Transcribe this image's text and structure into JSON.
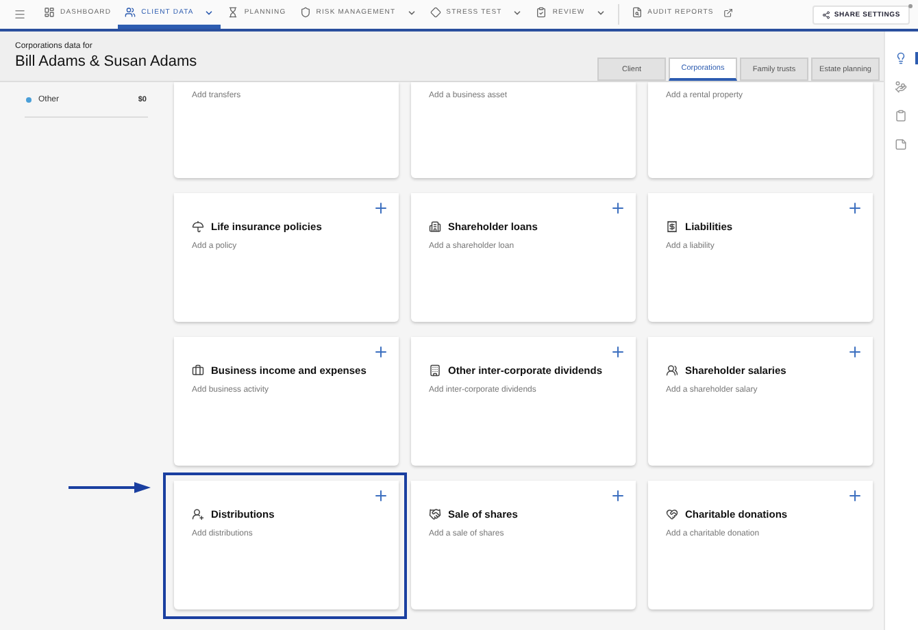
{
  "nav": {
    "items": [
      {
        "label": "DASHBOARD",
        "selected": false,
        "has_menu": false,
        "external": false
      },
      {
        "label": "CLIENT DATA",
        "selected": true,
        "has_menu": true,
        "external": false
      },
      {
        "label": "PLANNING",
        "selected": false,
        "has_menu": false,
        "external": false
      },
      {
        "label": "RISK MANAGEMENT",
        "selected": false,
        "has_menu": true,
        "external": false
      },
      {
        "label": "STRESS TEST",
        "selected": false,
        "has_menu": true,
        "external": false
      },
      {
        "label": "REVIEW",
        "selected": false,
        "has_menu": true,
        "external": false
      },
      {
        "label": "AUDIT REPORTS",
        "selected": false,
        "has_menu": false,
        "external": true
      }
    ],
    "share_button": "SHARE SETTINGS"
  },
  "header": {
    "subtitle": "Corporations data for",
    "title": "Bill Adams & Susan Adams"
  },
  "tabs": [
    {
      "label": "Client",
      "selected": false
    },
    {
      "label": "Corporations",
      "selected": true
    },
    {
      "label": "Family trusts",
      "selected": false
    },
    {
      "label": "Estate planning",
      "selected": false
    }
  ],
  "sidebar": {
    "items": [
      {
        "label": "Other",
        "value": "$0",
        "color": "#4a9fd8"
      }
    ]
  },
  "cards": [
    {
      "description": "Add transfers",
      "highlighted": false
    },
    {
      "description": "Add a business asset",
      "highlighted": false
    },
    {
      "description": "Add a rental property",
      "highlighted": false
    },
    {
      "title": "Life insurance policies",
      "description": "Add a policy",
      "highlighted": false
    },
    {
      "title": "Shareholder loans",
      "description": "Add a shareholder loan",
      "highlighted": false
    },
    {
      "title": "Liabilities",
      "description": "Add a liability",
      "highlighted": false
    },
    {
      "title": "Business income and expenses",
      "description": "Add business activity",
      "highlighted": false
    },
    {
      "title": "Other inter-corporate dividends",
      "description": "Add inter-corporate dividends",
      "highlighted": false
    },
    {
      "title": "Shareholder salaries",
      "description": "Add a shareholder salary",
      "highlighted": false
    },
    {
      "title": "Distributions",
      "description": "Add distributions",
      "highlighted": true
    },
    {
      "title": "Sale of shares",
      "description": "Add a sale of shares",
      "highlighted": false
    },
    {
      "title": "Charitable donations",
      "description": "Add a charitable donation",
      "highlighted": false
    }
  ],
  "rail": {
    "items": [
      {
        "selected": true
      },
      {
        "selected": false
      },
      {
        "selected": false
      },
      {
        "selected": false
      }
    ]
  }
}
